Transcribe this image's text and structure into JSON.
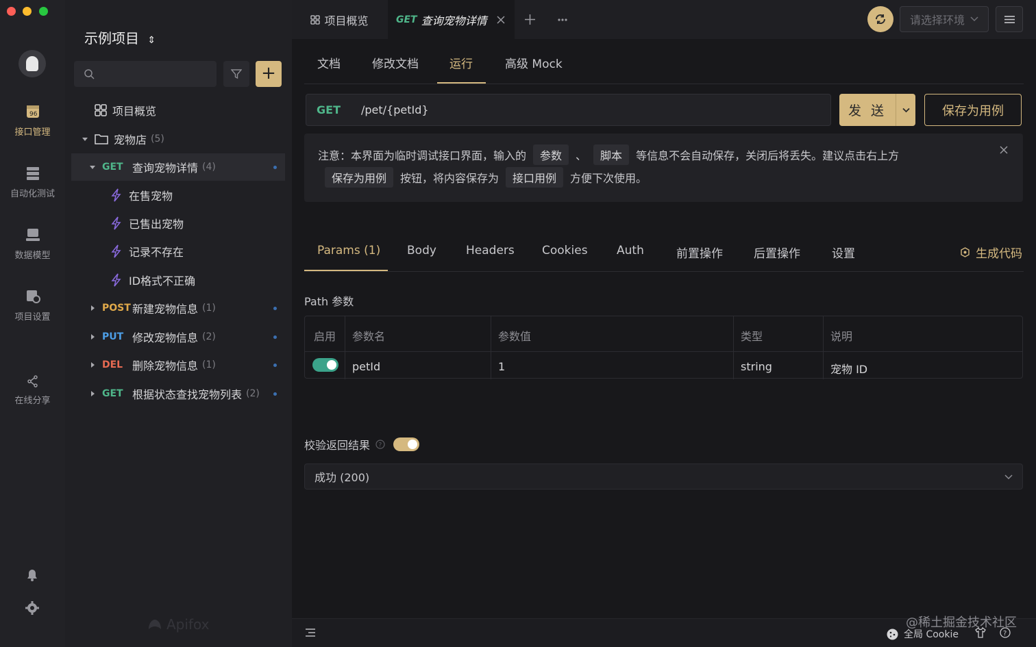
{
  "app": {
    "brand": "Apifox"
  },
  "rail": {
    "items": [
      {
        "label": "接口管理",
        "icon": "api-icon",
        "active": true
      },
      {
        "label": "自动化测试",
        "icon": "test-icon",
        "active": false
      },
      {
        "label": "数据模型",
        "icon": "model-icon",
        "active": false
      },
      {
        "label": "项目设置",
        "icon": "settings-icon",
        "active": false
      },
      {
        "label": "在线分享",
        "icon": "share-icon",
        "active": false
      }
    ]
  },
  "tree": {
    "project_title": "示例项目",
    "search_placeholder": "",
    "overview_label": "项目概览",
    "folder": {
      "label": "宠物店",
      "count": "(5)"
    },
    "selected": {
      "method": "GET",
      "label": "查询宠物详情",
      "count": "(4)"
    },
    "cases": [
      "在售宠物",
      "已售出宠物",
      "记录不存在",
      "ID格式不正确"
    ],
    "apis": [
      {
        "method": "POST",
        "label": "新建宠物信息",
        "count": "(1)"
      },
      {
        "method": "PUT",
        "label": "修改宠物信息",
        "count": "(2)"
      },
      {
        "method": "DEL",
        "label": "删除宠物信息",
        "count": "(1)"
      },
      {
        "method": "GET",
        "label": "根据状态查找宠物列表",
        "count": "(2)"
      }
    ]
  },
  "tabs": {
    "overview": "项目概览",
    "active_method": "GET",
    "active_title": "查询宠物详情",
    "env_placeholder": "请选择环境"
  },
  "subtabs": [
    "文档",
    "修改文档",
    "运行",
    "高级 Mock"
  ],
  "request": {
    "method": "GET",
    "path": "/pet/{petId}",
    "send_label": "发 送",
    "save_case_label": "保存为用例"
  },
  "notice": {
    "text1": "注意：本界面为临时调试接口界面，输入的",
    "chip1": "参数",
    "sep": "、",
    "chip2": "脚本",
    "text2": "等信息不会自动保存，关闭后将丢失。建议点击右上方",
    "chip3": "保存为用例",
    "text3": "按钮，将内容保存为",
    "chip4": "接口用例",
    "text4": "方便下次使用。"
  },
  "param_tabs": [
    "Params (1)",
    "Body",
    "Headers",
    "Cookies",
    "Auth",
    "前置操作",
    "后置操作",
    "设置"
  ],
  "gen_code_label": "生成代码",
  "path_params": {
    "section": "Path 参数",
    "headers": [
      "启用",
      "参数名",
      "参数值",
      "类型",
      "说明"
    ],
    "row": {
      "enabled": true,
      "name": "petId",
      "value": "1",
      "type": "string",
      "desc": "宠物 ID"
    }
  },
  "verify": {
    "label": "校验返回结果",
    "enabled": true,
    "result": "成功 (200)"
  },
  "status_bar": {
    "cookie_label": "全局 Cookie"
  },
  "watermark": "@稀土掘金技术社区",
  "colors": {
    "accent": "#d5b980",
    "get": "#4fb68a",
    "post": "#e0a94a",
    "put": "#4d9ee6",
    "del": "#e76a52"
  }
}
